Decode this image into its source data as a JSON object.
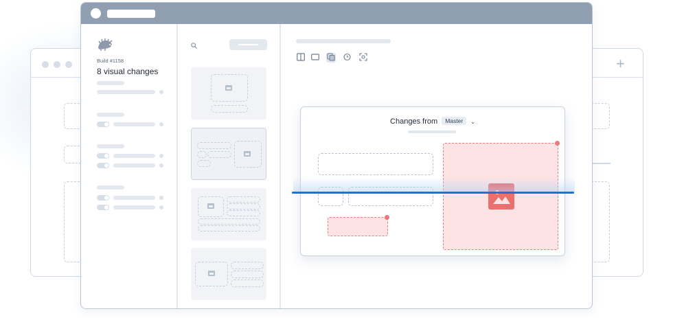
{
  "build": {
    "label": "Build #1158",
    "title": "8 visual changes"
  },
  "comparison": {
    "heading": "Changes from",
    "branch": "Master"
  },
  "colors": {
    "titlebar": "#919fb2",
    "accent_scan": "#1e6fe0",
    "change_highlight": "#ea6f6f",
    "change_fill": "#fde3e3"
  },
  "icons": {
    "logo": "hedgehog-logo-icon",
    "search": "search-icon",
    "add_tab": "plus-icon",
    "branch_dropdown": "chevron-down-icon",
    "toolbar": [
      "split-view-icon",
      "single-view-icon",
      "diff-view-icon",
      "history-icon",
      "focus-icon"
    ]
  }
}
